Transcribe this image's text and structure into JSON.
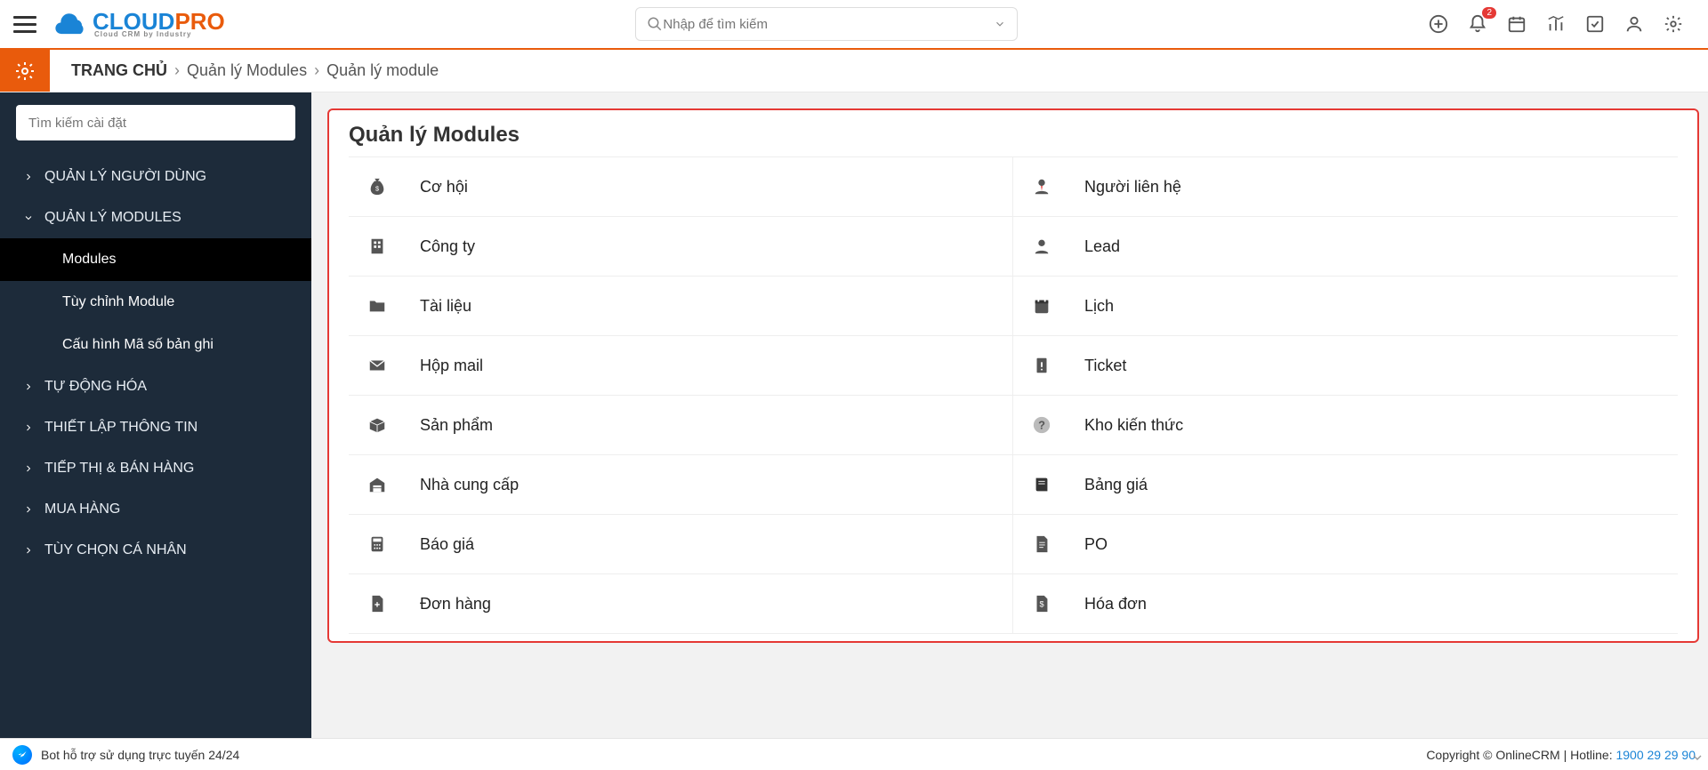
{
  "header": {
    "logo_cloud": "CLOUD",
    "logo_pro": "PRO",
    "logo_tagline": "Cloud CRM by Industry",
    "search_placeholder": "Nhập để tìm kiếm",
    "notification_count": "2"
  },
  "breadcrumb": {
    "home": "TRANG CHỦ",
    "crumb1": "Quản lý Modules",
    "crumb2": "Quản lý module"
  },
  "sidebar": {
    "search_placeholder": "Tìm kiếm cài đặt",
    "items": [
      {
        "label": "QUẢN LÝ NGƯỜI DÙNG",
        "expanded": false
      },
      {
        "label": "QUẢN LÝ MODULES",
        "expanded": true,
        "children": [
          {
            "label": "Modules",
            "active": true
          },
          {
            "label": "Tùy chỉnh Module",
            "active": false
          },
          {
            "label": "Cấu hình Mã số bản ghi",
            "active": false
          }
        ]
      },
      {
        "label": "TỰ ĐỘNG HÓA",
        "expanded": false
      },
      {
        "label": "THIẾT LẬP THÔNG TIN",
        "expanded": false
      },
      {
        "label": "TIẾP THỊ & BÁN HÀNG",
        "expanded": false
      },
      {
        "label": "MUA HÀNG",
        "expanded": false
      },
      {
        "label": "TÙY CHỌN CÁ NHÂN",
        "expanded": false
      }
    ]
  },
  "panel": {
    "title": "Quản lý Modules",
    "modules_left": [
      {
        "icon": "moneybag",
        "label": "Cơ hội"
      },
      {
        "icon": "building",
        "label": "Công ty"
      },
      {
        "icon": "folder",
        "label": "Tài liệu"
      },
      {
        "icon": "mail",
        "label": "Hộp mail"
      },
      {
        "icon": "box",
        "label": "Sản phẩm"
      },
      {
        "icon": "warehouse",
        "label": "Nhà cung cấp"
      },
      {
        "icon": "calc",
        "label": "Báo giá"
      },
      {
        "icon": "doc-export",
        "label": "Đơn hàng"
      }
    ],
    "modules_right": [
      {
        "icon": "person-tie",
        "label": "Người liên hệ"
      },
      {
        "icon": "person",
        "label": "Lead"
      },
      {
        "icon": "calendar",
        "label": "Lịch"
      },
      {
        "icon": "ticket",
        "label": "Ticket"
      },
      {
        "icon": "question",
        "label": "Kho kiến thức"
      },
      {
        "icon": "book",
        "label": "Bảng giá"
      },
      {
        "icon": "doc",
        "label": "PO"
      },
      {
        "icon": "doc-money",
        "label": "Hóa đơn"
      }
    ]
  },
  "footer": {
    "bot_text": "Bot hỗ trợ sử dụng trực tuyến 24/24",
    "copyright": "Copyright © OnlineCRM",
    "hotline_label": "Hotline:",
    "hotline_number": "1900 29 29 90"
  }
}
